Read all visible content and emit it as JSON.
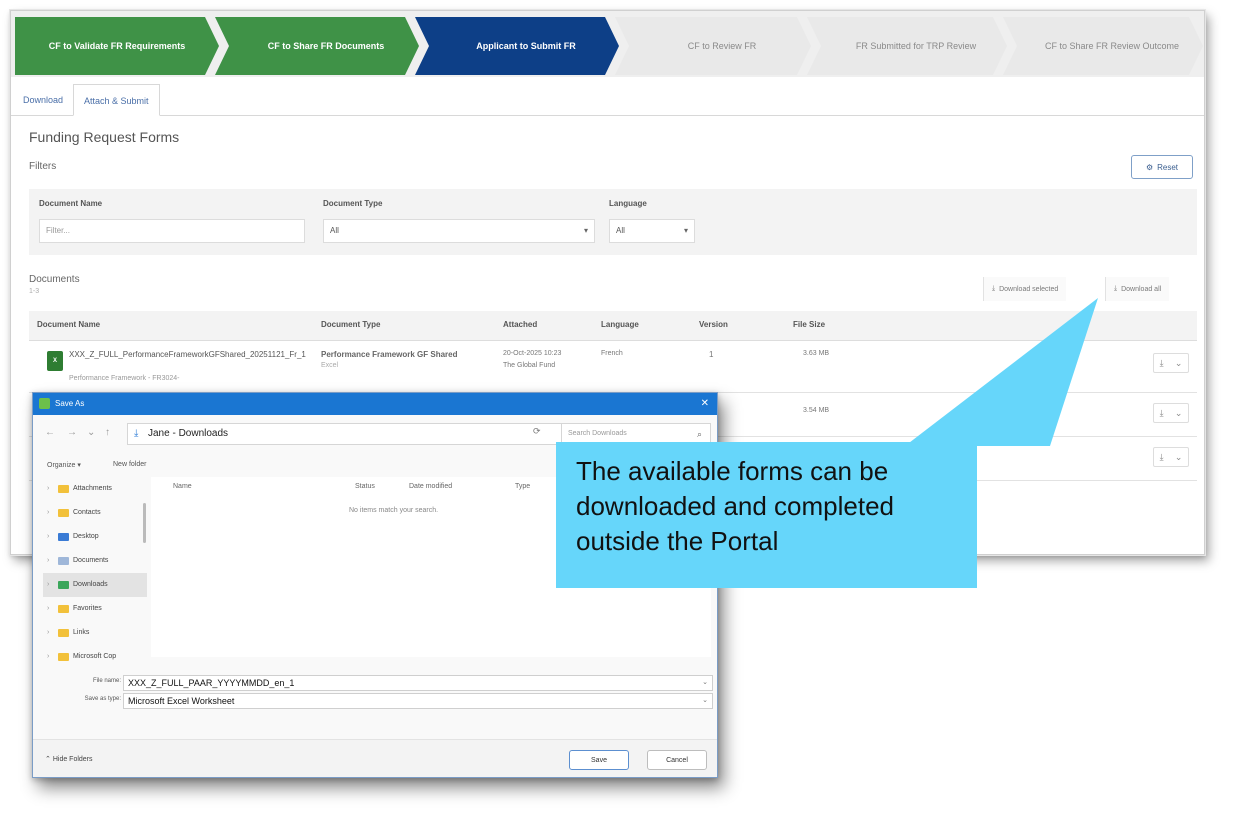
{
  "stepper": {
    "steps": [
      {
        "label": "CF to Validate FR Requirements"
      },
      {
        "label": "CF to Share FR Documents"
      },
      {
        "label": "Applicant to Submit FR"
      },
      {
        "label": "CF to Review FR"
      },
      {
        "label": "FR Submitted for TRP Review"
      },
      {
        "label": "CF to Share FR Review Outcome"
      }
    ]
  },
  "tabs": [
    {
      "label": "Download"
    },
    {
      "label": "Attach & Submit"
    }
  ],
  "page": {
    "title": "Funding Request Forms",
    "filters_label": "Filters",
    "reset_label": "Reset"
  },
  "filters": {
    "document_name": {
      "label": "Document Name",
      "placeholder": "Filter..."
    },
    "document_type": {
      "label": "Document Type",
      "value": "All"
    },
    "language": {
      "label": "Language",
      "value": "All"
    }
  },
  "documents": {
    "label": "Documents",
    "count": "1-3",
    "download_selected": "Download selected",
    "download_all": "Download all",
    "columns": [
      "Document Name",
      "Document Type",
      "Attached",
      "Language",
      "Version",
      "File Size"
    ],
    "rows": [
      {
        "name": "XXX_Z_FULL_PerformanceFrameworkGFShared_20251121_Fr_1",
        "subtitle": "Performance Framework - FR3024-",
        "type": "Performance Framework GF Shared",
        "type_sub": "Excel",
        "attached": "20-Oct-2025 10:23",
        "attached_by": "The Global Fund",
        "language": "French",
        "version": "1",
        "size": "3.63 MB"
      },
      {
        "size": "3.54 MB"
      }
    ]
  },
  "dialog": {
    "title": "Save As",
    "path": "Jane - Downloads",
    "search_placeholder": "Search Downloads",
    "organize": "Organize",
    "new_folder": "New folder",
    "tree": [
      {
        "label": "Attachments"
      },
      {
        "label": "Contacts"
      },
      {
        "label": "Desktop"
      },
      {
        "label": "Documents"
      },
      {
        "label": "Downloads"
      },
      {
        "label": "Favorites"
      },
      {
        "label": "Links"
      },
      {
        "label": "Microsoft Cop"
      }
    ],
    "columns": [
      "Name",
      "Status",
      "Date modified",
      "Type"
    ],
    "empty_message": "No items match your search.",
    "file_name_label": "File name:",
    "file_name": "XXX_Z_FULL_PAAR_YYYYMMDD_en_1",
    "save_type_label": "Save as type:",
    "save_type": "Microsoft Excel Worksheet",
    "hide_folders": "Hide Folders",
    "save": "Save",
    "cancel": "Cancel"
  },
  "callout": {
    "lines": [
      "The available forms can be",
      "downloaded and completed",
      "outside the Portal"
    ],
    "color": "#66d6fa"
  }
}
